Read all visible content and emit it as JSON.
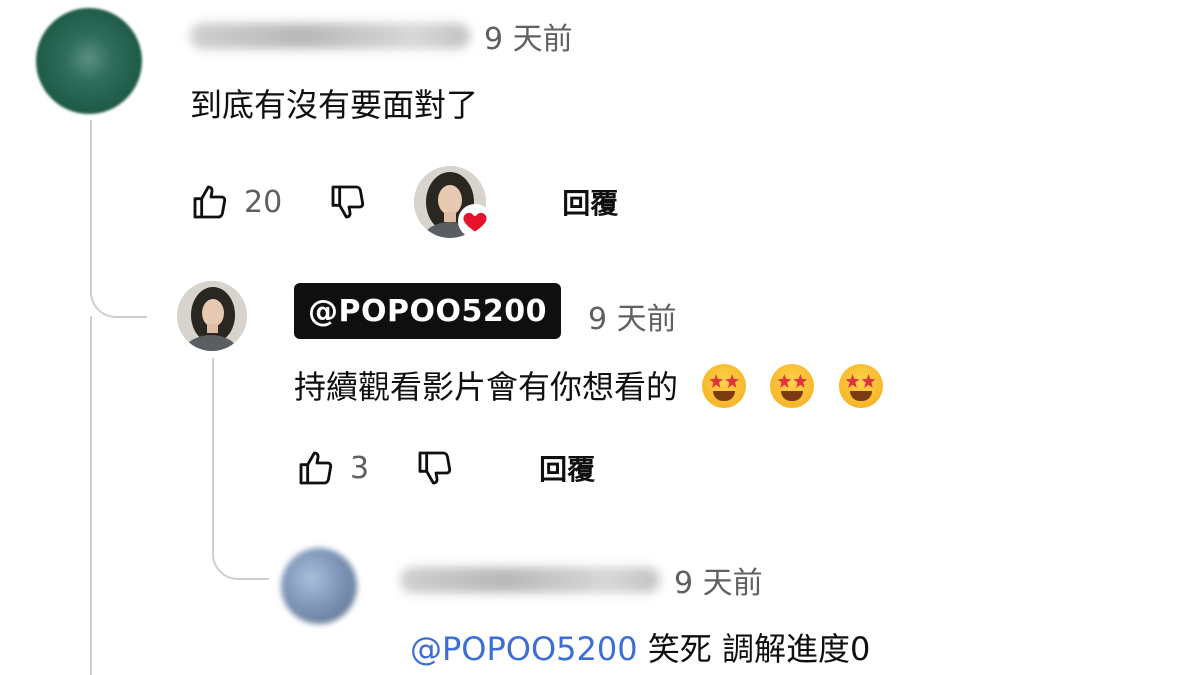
{
  "comments": [
    {
      "author": "",
      "time": "9 天前",
      "text": "到底有沒有要面對了",
      "likes": "20",
      "reply_label": "回覆"
    },
    {
      "author": "@POPOO5200",
      "time": "9 天前",
      "text": "持續觀看影片會有你想看的",
      "emojis": [
        "star-struck-emoji",
        "star-struck-emoji",
        "star-struck-emoji"
      ],
      "likes": "3",
      "reply_label": "回覆"
    },
    {
      "author": "",
      "time": "9 天前",
      "mention": "@POPOO5200",
      "text": " 笑死 調解進度0"
    }
  ],
  "icons": {
    "like": "thumbs-up-icon",
    "dislike": "thumbs-down-icon",
    "heart": "heart-icon"
  },
  "colors": {
    "mention": "#3b6fd6",
    "heart": "#e8112d",
    "meta": "#606060",
    "chip_bg": "#0f0f0f"
  }
}
